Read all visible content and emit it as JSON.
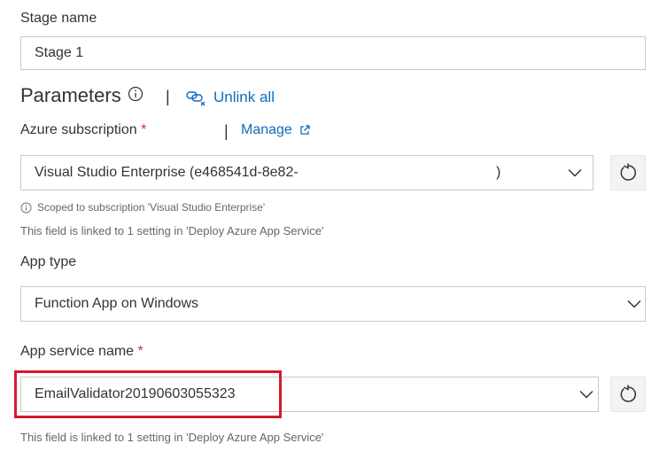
{
  "stage": {
    "label": "Stage name",
    "value": "Stage 1"
  },
  "parameters": {
    "heading": "Parameters",
    "separator": "|",
    "unlink_label": "Unlink all"
  },
  "subscription": {
    "label": "Azure subscription",
    "required_mark": "*",
    "separator": "|",
    "manage_label": "Manage",
    "selected_value": "Visual Studio Enterprise (e468541d-8e82-",
    "selected_value_tail": ")",
    "scope_note": "Scoped to subscription 'Visual Studio Enterprise'",
    "linked_note": "This field is linked to 1 setting in 'Deploy Azure App Service'"
  },
  "app_type": {
    "label": "App type",
    "selected_value": "Function App on Windows"
  },
  "app_service": {
    "label": "App service name",
    "required_mark": "*",
    "selected_value": "EmailValidator20190603055323",
    "linked_note": "This field is linked to 1 setting in 'Deploy Azure App Service'"
  },
  "colors": {
    "link": "#0f6cbd",
    "required": "#c4314b",
    "highlight": "#d7192c",
    "border": "#c8c8c8"
  }
}
